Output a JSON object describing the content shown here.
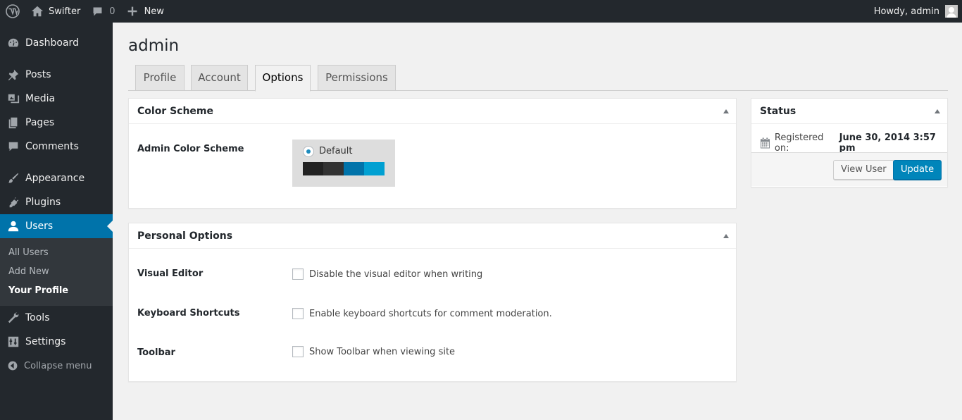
{
  "adminbar": {
    "site_name": "Swifter",
    "comments_count": "0",
    "new_label": "New",
    "howdy": "Howdy, admin"
  },
  "sidebar": {
    "items": [
      {
        "label": "Dashboard",
        "icon": "dashboard-icon"
      },
      {
        "label": "Posts",
        "icon": "pin-icon"
      },
      {
        "label": "Media",
        "icon": "media-icon"
      },
      {
        "label": "Pages",
        "icon": "pages-icon"
      },
      {
        "label": "Comments",
        "icon": "comment-icon"
      },
      {
        "label": "Appearance",
        "icon": "brush-icon"
      },
      {
        "label": "Plugins",
        "icon": "plug-icon"
      },
      {
        "label": "Users",
        "icon": "user-icon"
      },
      {
        "label": "Tools",
        "icon": "wrench-icon"
      },
      {
        "label": "Settings",
        "icon": "settings-icon"
      }
    ],
    "users_submenu": [
      "All Users",
      "Add New",
      "Your Profile"
    ],
    "collapse_label": "Collapse menu"
  },
  "page": {
    "title": "admin",
    "tabs": [
      "Profile",
      "Account",
      "Options",
      "Permissions"
    ],
    "active_tab": "Options"
  },
  "color_scheme_box": {
    "title": "Color Scheme",
    "field_label": "Admin Color Scheme",
    "scheme_name": "Default",
    "swatches": [
      "#222222",
      "#333333",
      "#0073aa",
      "#00a0d2"
    ]
  },
  "personal_options": {
    "title": "Personal Options",
    "rows": [
      {
        "label": "Visual Editor",
        "checkbox_label": "Disable the visual editor when writing",
        "checked": false
      },
      {
        "label": "Keyboard Shortcuts",
        "checkbox_label": "Enable keyboard shortcuts for comment moderation.",
        "checked": false
      },
      {
        "label": "Toolbar",
        "checkbox_label": "Show Toolbar when viewing site",
        "checked": false
      }
    ]
  },
  "status_box": {
    "title": "Status",
    "registered_label": "Registered on:",
    "registered_value": "June 30, 2014 3:57 pm",
    "view_user_label": "View User",
    "update_label": "Update"
  },
  "colors": {
    "accent": "#0073aa",
    "sidebar_bg": "#23282d",
    "submenu_bg": "#32373c",
    "page_bg": "#f1f1f1"
  }
}
